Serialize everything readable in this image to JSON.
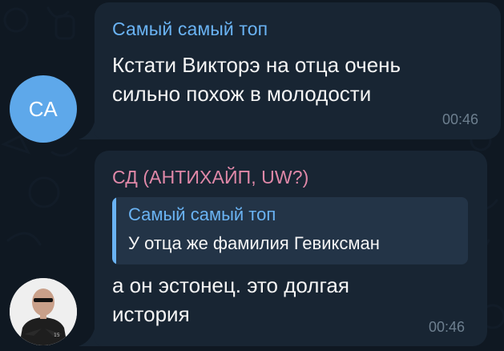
{
  "messages": [
    {
      "sender": "Самый самый топ",
      "avatar_initials": "СА",
      "text_lines": [
        "Кстати Викторэ на отца очень",
        "сильно похож в молодости"
      ],
      "time": "00:46"
    },
    {
      "sender": "СД (АНТИХАЙП, UW?)",
      "reply": {
        "sender": "Самый самый топ",
        "text": "У отца же фамилия Гевиксман"
      },
      "text_lines": [
        "а он эстонец. это долгая",
        "история"
      ],
      "time": "00:46"
    }
  ],
  "colors": {
    "background": "#0e1621",
    "bubble": "#182533",
    "sender_blue": "#6ab3f3",
    "sender_pink": "#e088a8",
    "avatar_blue": "#5ea8ea",
    "time": "#6d7f8f"
  }
}
